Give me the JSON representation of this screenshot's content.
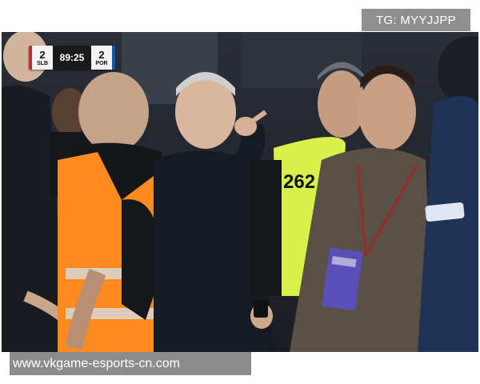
{
  "watermark": {
    "top_right": "TG: MYYJJPP",
    "bottom_left": "www.vkgame-esports-cn.com"
  },
  "scoreboard": {
    "home": {
      "score": "2",
      "abbr": "SLB",
      "color": "#d8232a"
    },
    "clock": "89:25",
    "away": {
      "score": "2",
      "abbr": "POR",
      "color": "#0c58a6"
    }
  },
  "steward": {
    "bib_number": "262"
  }
}
